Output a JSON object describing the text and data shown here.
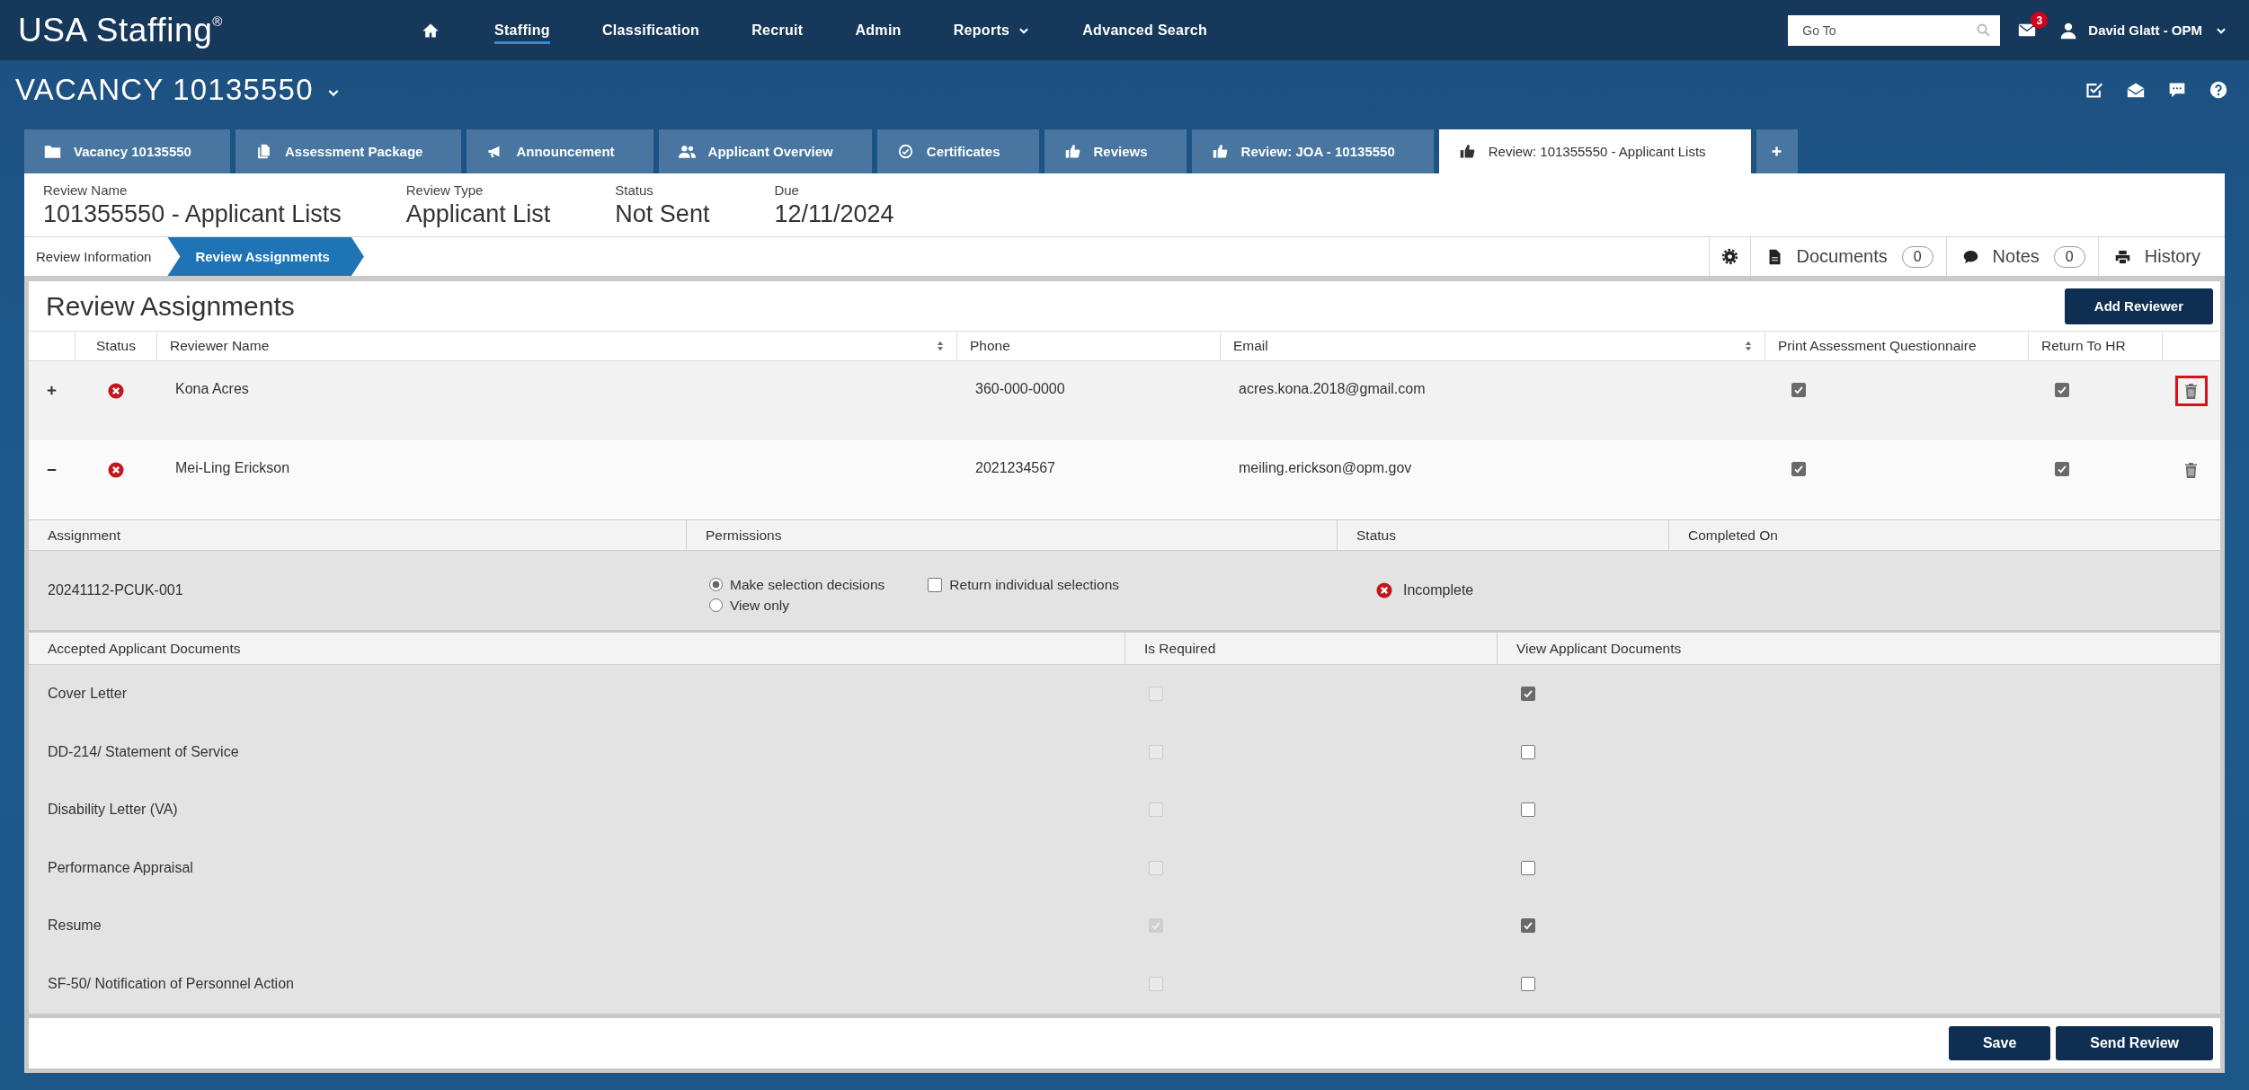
{
  "header": {
    "logo": "USA Staffing$^{®}$",
    "nav": [
      {
        "label": "Staffing",
        "selected": true,
        "has_menu": false
      },
      {
        "label": "Classification",
        "selected": false,
        "has_menu": false
      },
      {
        "label": "Recruit",
        "selected": false,
        "has_menu": false
      },
      {
        "label": "Admin",
        "selected": false,
        "has_menu": false
      },
      {
        "label": "Reports",
        "selected": false,
        "has_menu": true
      },
      {
        "label": "Advanced Search",
        "selected": false,
        "has_menu": false
      }
    ],
    "search": {
      "placeholder": "Go To"
    },
    "messages": {
      "badge": "3"
    },
    "user": {
      "name": "David Glatt - OPM"
    }
  },
  "vacancy": {
    "title": "VACANCY 10135550"
  },
  "tabs": [
    {
      "kind": "vacancy",
      "label": "Vacancy 10135550",
      "selected": false
    },
    {
      "kind": "assessment",
      "label": "Assessment Package",
      "selected": false
    },
    {
      "kind": "announcement",
      "label": "Announcement",
      "selected": false
    },
    {
      "kind": "applicants",
      "label": "Applicant Overview",
      "selected": false
    },
    {
      "kind": "certificates",
      "label": "Certificates",
      "selected": false
    },
    {
      "kind": "reviews",
      "label": "Reviews",
      "selected": false
    },
    {
      "kind": "review",
      "label": "Review: JOA - 10135550",
      "selected": false
    },
    {
      "kind": "review",
      "label": "Review: 101355550 - Applicant Lists",
      "selected": true
    }
  ],
  "review_info": [
    {
      "label": "Review Name",
      "value": "101355550 - Applicant Lists"
    },
    {
      "label": "Review Type",
      "value": "Applicant List"
    },
    {
      "label": "Status",
      "value": "Not Sent"
    },
    {
      "label": "Due",
      "value": "12/11/2024"
    }
  ],
  "steps": [
    {
      "label": "Review Information",
      "selected": false
    },
    {
      "label": "Review Assignments",
      "selected": true
    }
  ],
  "toolbar": [
    {
      "kind": "documents",
      "label": "Documents",
      "count": "0"
    },
    {
      "kind": "notes",
      "label": "Notes",
      "count": "0"
    },
    {
      "kind": "history",
      "label": "History"
    }
  ],
  "assignments": {
    "title": "Review Assignments",
    "add_button": "Add Reviewer",
    "columns": [
      {
        "label": "Status",
        "sortable": false
      },
      {
        "label": "Reviewer Name",
        "sortable": true
      },
      {
        "label": "Phone",
        "sortable": false
      },
      {
        "label": "Email",
        "sortable": true
      },
      {
        "label": "Print Assessment Questionnaire",
        "sortable": false
      },
      {
        "label": "Return To HR",
        "sortable": false
      }
    ],
    "reviewers": [
      {
        "expanded": false,
        "complete": false,
        "name": "Kona Acres",
        "phone": "360-000-0000",
        "email": "acres.kona.2018@gmail.com",
        "print_questionnaire": true,
        "return_to_hr": true,
        "delete_highlighted": true
      },
      {
        "expanded": true,
        "complete": false,
        "name": "Mei-Ling Erickson",
        "phone": "2021234567",
        "email": "meiling.erickson@opm.gov",
        "print_questionnaire": true,
        "return_to_hr": true,
        "delete_highlighted": false,
        "detail": {
          "columns": [
            "Assignment",
            "Permissions",
            "Status",
            "Completed On"
          ],
          "assignment": "20241112-PCUK-001",
          "permissions": [
            {
              "label": "Make selection decisions",
              "selected": true
            },
            {
              "label": "View only",
              "selected": false
            }
          ],
          "return_individual": {
            "label": "Return individual selections",
            "checked": false
          },
          "status": {
            "label": "Incomplete",
            "complete": false
          },
          "documents": {
            "columns": [
              "Accepted Applicant Documents",
              "Is Required",
              "View Applicant Documents"
            ],
            "rows": [
              {
                "name": "Cover Letter",
                "required": false,
                "required_disabled": true,
                "view": true
              },
              {
                "name": "DD-214/ Statement of Service",
                "required": false,
                "required_disabled": true,
                "view": false
              },
              {
                "name": "Disability Letter (VA)",
                "required": false,
                "required_disabled": true,
                "view": false
              },
              {
                "name": "Performance Appraisal",
                "required": false,
                "required_disabled": true,
                "view": false
              },
              {
                "name": "Resume",
                "required": true,
                "required_disabled": true,
                "view": true
              },
              {
                "name": "SF-50/ Notification of Personnel Action",
                "required": false,
                "required_disabled": true,
                "view": false
              }
            ]
          }
        }
      }
    ]
  },
  "footer": {
    "buttons": [
      "Save",
      "Send Review"
    ]
  }
}
